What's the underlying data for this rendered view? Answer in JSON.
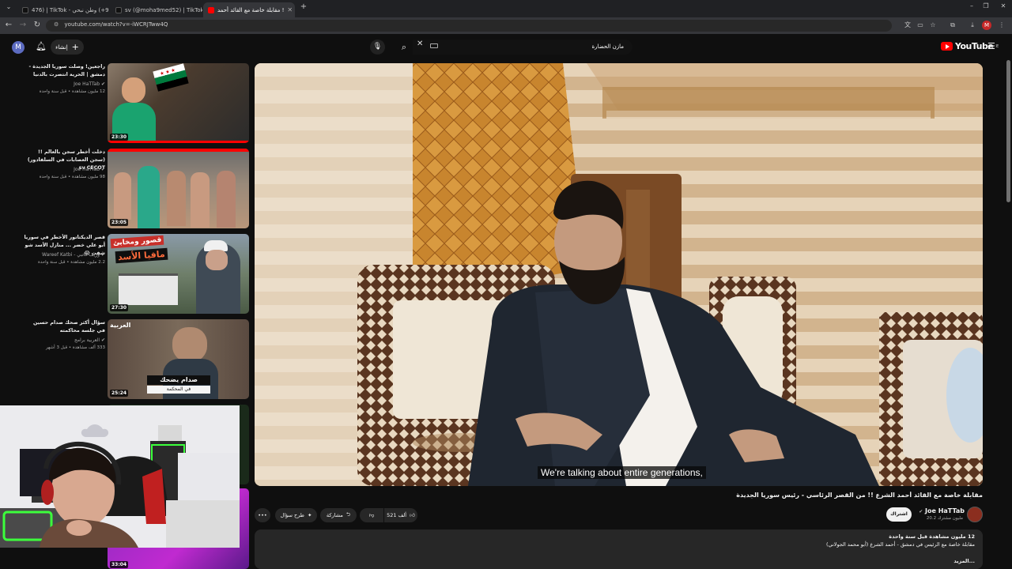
{
  "browser": {
    "tabs": [
      {
        "title": "476) | TikTok - ‏وطن نبحي (‎+99",
        "active": false,
        "icon": "tiktok-icon"
      },
      {
        "title": "sv (@moha9med52) | TikTok",
        "active": false,
        "icon": "tiktok-icon"
      },
      {
        "title": "مقابلة خاصة مع القائد أحمد !",
        "active": true,
        "icon": "youtube-icon"
      }
    ],
    "new_tab": "+",
    "url": "youtube.com/watch?v=-iWCRJTww4Q",
    "profile_initial": "M"
  },
  "masthead": {
    "account_initial": "M",
    "create_label": "إنشاء",
    "search_query": "مازن الحضارة",
    "logo_text": "YouTube",
    "logo_region": "IE"
  },
  "related": [
    {
      "title": "راجعين! وصلت سوريا الجديدة - دمشق | الحرية انتصرت بالدنيا",
      "channel": "Joe HaTTab",
      "meta": "12 مليون مشاهدة • قبل سنة واحدة",
      "duration": "23:30"
    },
    {
      "title": "دخلت أخطر سجن بالعالم !! (سجن العصابات في السلفادور) sv CECOT",
      "channel": "Joe HaTTab",
      "meta": "98 مليون مشاهدة • قبل سنة واحدة",
      "duration": "23:05"
    },
    {
      "title": "قصر الديكتاتور الأخطر في سوريا أبو علي خضر ... منازل الأسد شو شفت 😱",
      "channel": "Wareef Katbi - وريف كاتبي",
      "meta": "2.2 مليون مشاهدة • قبل سنة واحدة",
      "duration": "27:30"
    },
    {
      "title": "سؤال أكثر صحك صدام حسين في جلسة محاكمته",
      "channel": "العربية برامج",
      "meta": "333 ألف مشاهدة • قبل 3 أشهر",
      "duration": "25:24"
    },
    {
      "title": "",
      "channel": "",
      "meta": "",
      "duration": "33:04"
    }
  ],
  "thumb_texts": {
    "t3_line1": "قصور ومخابئ",
    "t3_line2": "مافيا الأسد",
    "t4_logo": "العربية",
    "t4_banner": "صدام يضحك",
    "t4_sub": "في المحكمة"
  },
  "player": {
    "caption": "We're talking about entire generations,"
  },
  "video": {
    "title": "مقابلة خاصة مع القائد أحمد الشرع !! من القصر الرئاسي - رئيس سوريا الجديدة",
    "channel": "Joe HaTTab",
    "subscribers": "20.2 مليون مشترك",
    "subscribe_label": "اشتراك",
    "likes": "521 ألف",
    "share_label": "مشاركة",
    "ask_label": "طرح سؤال",
    "more": "•••",
    "views_line": "12 مليون مشاهدة  قبل سنة واحدة",
    "desc_line": "مقابلة خاصة مع الرئيس في دمشق - أحمد الشرع  (أبو محمد الجولاني)",
    "more_label": "...المزيد"
  },
  "colors": {
    "background": "#0f0f0f",
    "accent_red": "#ff0000",
    "chrome_dark": "#202124"
  }
}
